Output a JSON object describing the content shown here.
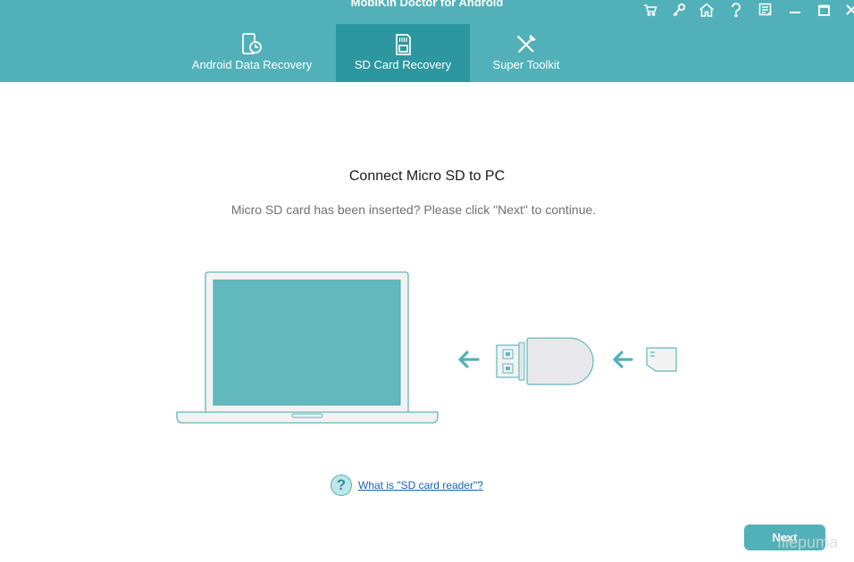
{
  "app": {
    "title": "MobiKin Doctor for Android"
  },
  "window_controls": [
    {
      "name": "cart-icon"
    },
    {
      "name": "key-icon"
    },
    {
      "name": "home-icon"
    },
    {
      "name": "help-icon"
    },
    {
      "name": "feedback-icon"
    },
    {
      "name": "minimize-icon"
    },
    {
      "name": "maximize-icon"
    },
    {
      "name": "close-icon"
    }
  ],
  "tabs": [
    {
      "label": "Android Data Recovery",
      "icon": "phone-clock-icon",
      "active": false
    },
    {
      "label": "SD Card Recovery",
      "icon": "sd-card-icon",
      "active": true
    },
    {
      "label": "Super Toolkit",
      "icon": "tools-icon",
      "active": false
    }
  ],
  "main": {
    "title": "Connect Micro SD to PC",
    "subtitle": "Micro SD card has been inserted? Please click \"Next\" to continue.",
    "help_link": "What is \"SD card reader\"?",
    "next_label": "Next"
  },
  "watermark": "filepuma",
  "colors": {
    "header": "#52b1b8",
    "active_tab": "#2d979f",
    "accent": "#52b1b8",
    "screen": "#62b9bd",
    "link": "#1a62b5"
  }
}
